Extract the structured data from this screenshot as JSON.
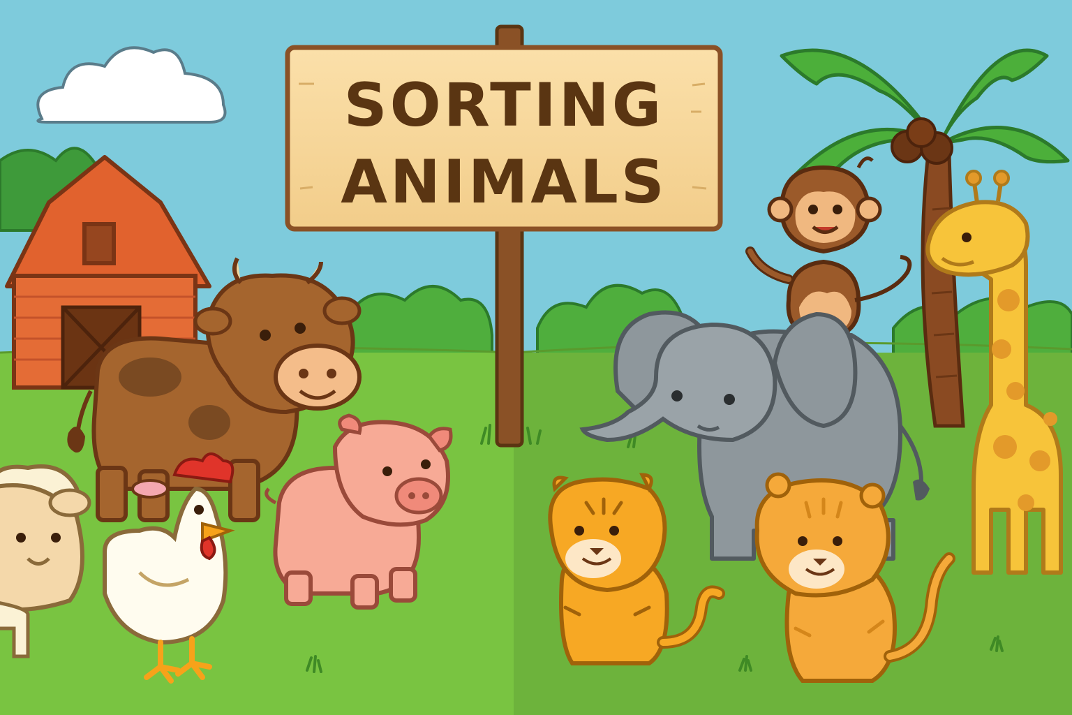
{
  "sign": {
    "line1": "SORTING",
    "line2": "ANIMALS"
  },
  "scenes": {
    "farm": {
      "animals": [
        "sheep",
        "cow",
        "chicken",
        "pig"
      ],
      "props": [
        "barn",
        "cloud",
        "bushes"
      ]
    },
    "wild": {
      "animals": [
        "monkey",
        "elephant",
        "giraffe",
        "tiger-cub-left",
        "tiger-cub-right"
      ],
      "props": [
        "palm-tree",
        "bushes"
      ]
    }
  },
  "colors": {
    "sky": "#7ecbdc",
    "farm_grass": "#79c441",
    "wild_grass": "#6db33c",
    "sign_board": "#f8d79c",
    "sign_text": "#5a3512",
    "outline": "#7a4a1e"
  }
}
